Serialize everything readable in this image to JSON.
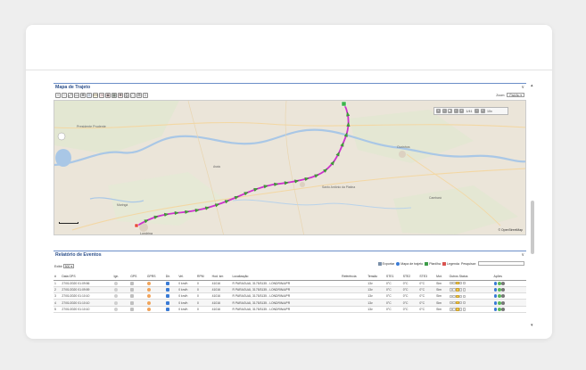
{
  "map_panel": {
    "title": "Mapa de Trajeto",
    "zoom_label": "Zoom:",
    "zoom_value": "Padrão",
    "nav": {
      "page": "1/41",
      "speed": "10x"
    },
    "credit": "© OpenStreetMap",
    "toolbar_icons": [
      "zoom-in-icon",
      "zoom-out-icon",
      "zoom-extent-icon",
      "zoom-box-icon",
      "pan-icon",
      "layers-icon",
      "measure-icon",
      "route-icon",
      "marker-icon",
      "traffic-icon",
      "poi-icon",
      "print-icon",
      "fullscreen-icon",
      "settings-icon",
      "export-icon"
    ],
    "places": [
      {
        "name": "Presidente Prudente",
        "color": "#555"
      },
      {
        "name": "Ourinhos",
        "color": "#555"
      },
      {
        "name": "Londrina",
        "color": "#555"
      },
      {
        "name": "Assis",
        "color": "#555"
      },
      {
        "name": "Santo Antônio da Platina",
        "color": "#555"
      },
      {
        "name": "Cambará",
        "color": "#555"
      },
      {
        "name": "Maringá",
        "color": "#555"
      }
    ]
  },
  "events_panel": {
    "title": "Relatório de Eventos",
    "page_size_label": "Exibir",
    "page_size": "500",
    "actions": {
      "export": "Exportar",
      "route_map": "Mapa de trajeto",
      "sheet": "Planilha",
      "legend": "Legenda"
    },
    "search_label": "Pesquisar:",
    "columns": [
      "#",
      "Data GPS",
      "Ign.",
      "GPS",
      "GPRS",
      "Dir.",
      "Vel.",
      "RPM",
      "Hod. km",
      "Localização",
      "Referência",
      "Tensão",
      "STE1",
      "STE2",
      "STE3",
      "Mot.",
      "Outros Status",
      "Ações"
    ],
    "rows": [
      {
        "n": "1",
        "date": "27/01/2020 01:09:56",
        "vel": "0 km/h",
        "rpm": "0",
        "hod": "41016",
        "loc": "R PARAGUAI, 3175/3135 - LONDRINA/PR",
        "volt": "13v",
        "s1": "0°C",
        "s2": "0°C",
        "s3": "0°C",
        "mot": "Sim"
      },
      {
        "n": "2",
        "date": "27/01/2020 01:09:59",
        "vel": "0 km/h",
        "rpm": "0",
        "hod": "41016",
        "loc": "R PARAGUAI, 3175/3135 - LONDRINA/PR",
        "volt": "13v",
        "s1": "0°C",
        "s2": "0°C",
        "s3": "0°C",
        "mot": "Sim"
      },
      {
        "n": "3",
        "date": "27/01/2020 01:10:10",
        "vel": "0 km/h",
        "rpm": "0",
        "hod": "41016",
        "loc": "R PARAGUAI, 3175/3135 - LONDRINA/PR",
        "volt": "13v",
        "s1": "0°C",
        "s2": "0°C",
        "s3": "0°C",
        "mot": "Sim"
      },
      {
        "n": "4",
        "date": "27/01/2020 01:10:10",
        "vel": "0 km/h",
        "rpm": "0",
        "hod": "41016",
        "loc": "R PARAGUAI, 3175/3135 - LONDRINA/PR",
        "volt": "13v",
        "s1": "0°C",
        "s2": "0°C",
        "s3": "0°C",
        "mot": "Sim"
      },
      {
        "n": "5",
        "date": "27/01/2020 01:10:10",
        "vel": "0 km/h",
        "rpm": "0",
        "hod": "41016",
        "loc": "R PARAGUAI, 3175/3135 - LONDRINA/PR",
        "volt": "13v",
        "s1": "0°C",
        "s2": "0°C",
        "s3": "0°C",
        "mot": "Sim"
      }
    ]
  }
}
